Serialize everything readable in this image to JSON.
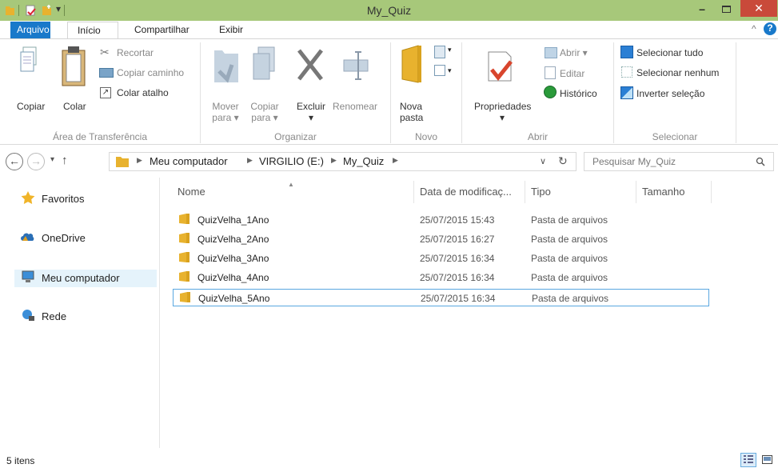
{
  "window": {
    "title": "My_Quiz"
  },
  "tabs": [
    "Arquivo",
    "Início",
    "Compartilhar",
    "Exibir"
  ],
  "ribbon": {
    "clipboard": {
      "copy": "Copiar",
      "paste": "Colar",
      "cut": "Recortar",
      "copy_path": "Copiar caminho",
      "paste_shortcut": "Colar atalho",
      "group": "Área de Transferência"
    },
    "organize": {
      "move_1": "Mover",
      "move_2": "para",
      "copy_1": "Copiar",
      "copy_2": "para",
      "delete": "Excluir",
      "rename": "Renomear",
      "group": "Organizar"
    },
    "new": {
      "new_1": "Nova",
      "new_2": "pasta",
      "group": "Novo"
    },
    "open": {
      "properties": "Propriedades",
      "open": "Abrir",
      "edit": "Editar",
      "history": "Histórico",
      "group": "Abrir"
    },
    "select": {
      "all": "Selecionar tudo",
      "none": "Selecionar nenhum",
      "invert": "Inverter seleção",
      "group": "Selecionar"
    }
  },
  "address": {
    "crumbs": [
      "Meu computador",
      "VIRGILIO (E:)",
      "My_Quiz"
    ],
    "search_placeholder": "Pesquisar My_Quiz"
  },
  "nav": {
    "favorites": "Favoritos",
    "onedrive": "OneDrive",
    "computer": "Meu computador",
    "network": "Rede"
  },
  "columns": {
    "name": "Nome",
    "date": "Data de modificaç...",
    "type": "Tipo",
    "size": "Tamanho"
  },
  "files": [
    {
      "name": "QuizVelha_1Ano",
      "date": "25/07/2015 15:43",
      "type": "Pasta de arquivos"
    },
    {
      "name": "QuizVelha_2Ano",
      "date": "25/07/2015 16:27",
      "type": "Pasta de arquivos"
    },
    {
      "name": "QuizVelha_3Ano",
      "date": "25/07/2015 16:34",
      "type": "Pasta de arquivos"
    },
    {
      "name": "QuizVelha_4Ano",
      "date": "25/07/2015 16:34",
      "type": "Pasta de arquivos"
    },
    {
      "name": "QuizVelha_5Ano",
      "date": "25/07/2015 16:34",
      "type": "Pasta de arquivos"
    }
  ],
  "status": {
    "count": "5 itens"
  },
  "colors": {
    "titlebar": "#a7c87a",
    "file_tab": "#1979ca",
    "close": "#c94a3a",
    "selection": "#5aa7e0"
  }
}
